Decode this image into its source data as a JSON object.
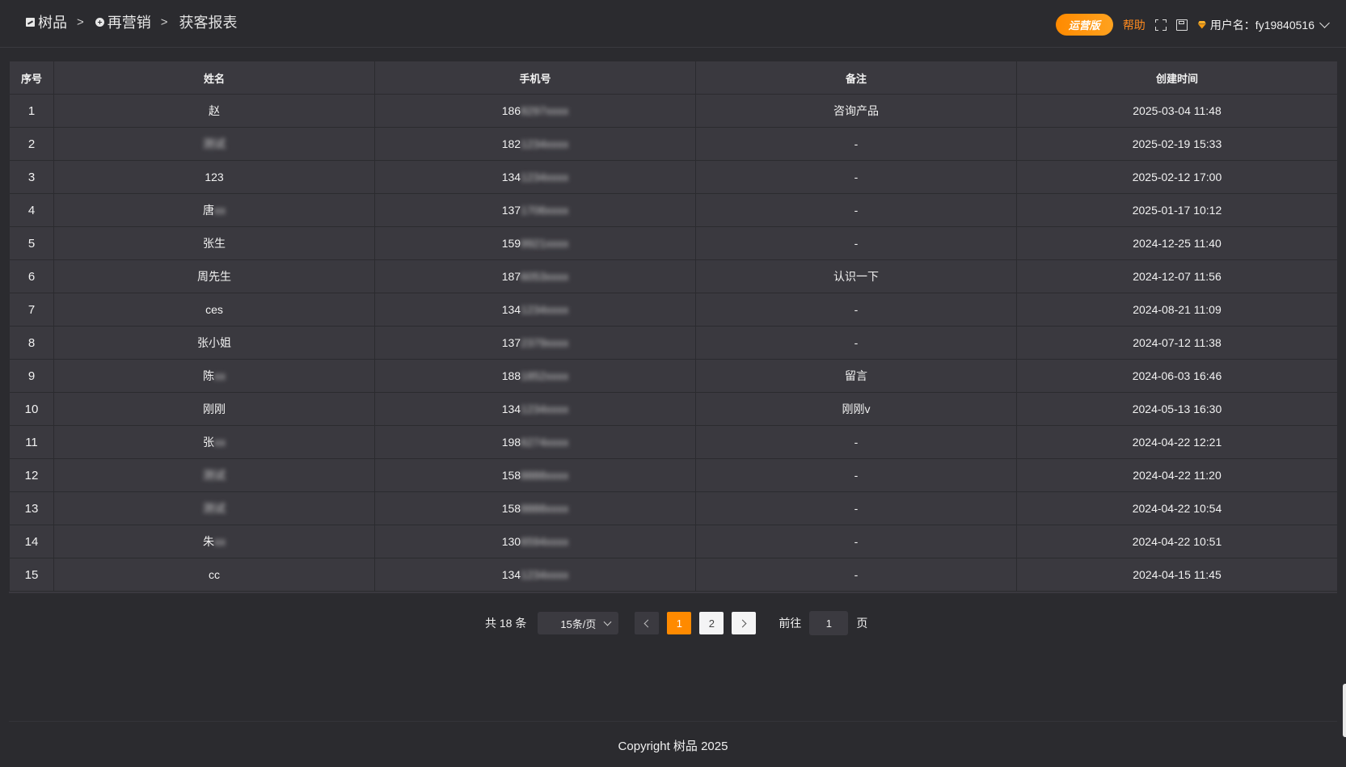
{
  "breadcrumb": {
    "items": [
      {
        "label": "树品",
        "icon": "image-icon"
      },
      {
        "label": "再营销",
        "icon": "circle-plus-icon"
      }
    ],
    "separator": ">",
    "current": "获客报表"
  },
  "header": {
    "edition": "运营版",
    "help": "帮助",
    "user_label": "用户名：fy19840516"
  },
  "table": {
    "columns": [
      "序号",
      "姓名",
      "手机号",
      "备注",
      "创建时间"
    ],
    "rows": [
      {
        "idx": "1",
        "name": "赵",
        "name_blur": "",
        "phone": "186",
        "phone_blur": "8297xxxx",
        "note": "咨询产品",
        "time": "2025-03-04 11:48"
      },
      {
        "idx": "2",
        "name": "",
        "name_blur": "测试",
        "phone": "182",
        "phone_blur": "1234xxxx",
        "note": "-",
        "time": "2025-02-19 15:33"
      },
      {
        "idx": "3",
        "name": "123",
        "name_blur": "",
        "phone": "134",
        "phone_blur": "1234xxxx",
        "note": "-",
        "time": "2025-02-12 17:00"
      },
      {
        "idx": "4",
        "name": "唐",
        "name_blur": "xx",
        "phone": "137",
        "phone_blur": "1706xxxx",
        "note": "-",
        "time": "2025-01-17 10:12"
      },
      {
        "idx": "5",
        "name": "张生",
        "name_blur": "",
        "phone": "159",
        "phone_blur": "9921xxxx",
        "note": "-",
        "time": "2024-12-25 11:40"
      },
      {
        "idx": "6",
        "name": "周先生",
        "name_blur": "",
        "phone": "187",
        "phone_blur": "6053xxxx",
        "note": "认识一下",
        "time": "2024-12-07 11:56"
      },
      {
        "idx": "7",
        "name": "ces",
        "name_blur": "",
        "phone": "134",
        "phone_blur": "1234xxxx",
        "note": "-",
        "time": "2024-08-21 11:09"
      },
      {
        "idx": "8",
        "name": "张小姐",
        "name_blur": "",
        "phone": "137",
        "phone_blur": "2379xxxx",
        "note": "-",
        "time": "2024-07-12 11:38"
      },
      {
        "idx": "9",
        "name": "陈",
        "name_blur": "xx",
        "phone": "188",
        "phone_blur": "1852xxxx",
        "note": "留言",
        "time": "2024-06-03 16:46"
      },
      {
        "idx": "10",
        "name": "刚刚",
        "name_blur": "",
        "phone": "134",
        "phone_blur": "1234xxxx",
        "note": "刚刚v",
        "time": "2024-05-13 16:30"
      },
      {
        "idx": "11",
        "name": "张",
        "name_blur": "xx",
        "phone": "198",
        "phone_blur": "6274xxxx",
        "note": "-",
        "time": "2024-04-22 12:21"
      },
      {
        "idx": "12",
        "name": "",
        "name_blur": "测试",
        "phone": "158",
        "phone_blur": "8888xxxx",
        "note": "-",
        "time": "2024-04-22 11:20"
      },
      {
        "idx": "13",
        "name": "",
        "name_blur": "测试",
        "phone": "158",
        "phone_blur": "8888xxxx",
        "note": "-",
        "time": "2024-04-22 10:54"
      },
      {
        "idx": "14",
        "name": "朱",
        "name_blur": "xx",
        "phone": "130",
        "phone_blur": "6594xxxx",
        "note": "-",
        "time": "2024-04-22 10:51"
      },
      {
        "idx": "15",
        "name": "cc",
        "name_blur": "",
        "phone": "134",
        "phone_blur": "1234xxxx",
        "note": "-",
        "time": "2024-04-15 11:45"
      }
    ]
  },
  "pagination": {
    "total": "共 18 条",
    "page_size": "15条/页",
    "pages": [
      "1",
      "2"
    ],
    "current_page": "1",
    "goto_label": "前往",
    "goto_value": "1",
    "goto_suffix": "页"
  },
  "footer": {
    "copyright": "Copyright 树品 2025"
  },
  "colors": {
    "accent": "#ff8a00",
    "background": "#2b2b2f",
    "table_bg": "#3a393f"
  }
}
